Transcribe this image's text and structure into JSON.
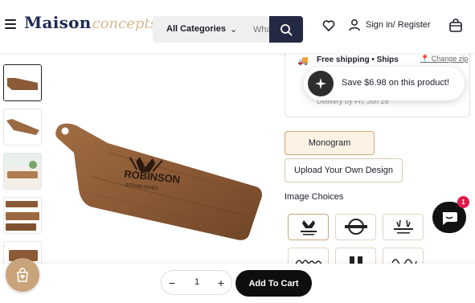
{
  "header": {
    "logo_main": "Maison",
    "logo_sub": "concepts",
    "category_select": "All Categories",
    "search_placeholder": "What are you looking for?",
    "signin_label": "Sign in/ Register"
  },
  "shipping": {
    "title": "Free shipping • Ships",
    "change_zip": "Change zip",
    "delivery": "Delivery by Fri, Jun 28"
  },
  "promo": {
    "text": "Save $6.98 on this product!"
  },
  "options": {
    "monogram_label": "Monogram",
    "upload_label": "Upload Your Own Design",
    "image_choices_label": "Image Choices"
  },
  "chat": {
    "badge_count": "1"
  },
  "product_image": {
    "engraving_line1": "ROBINSON",
    "engraving_line2": "ESTABLISHED"
  },
  "cart_bar": {
    "quantity": "1",
    "minus": "−",
    "plus": "+",
    "add_to_cart": "Add To Cart"
  },
  "colors": {
    "navy": "#242842",
    "gold": "#d9b98e",
    "wood": "#8b5a36",
    "bag_button": "#c9a47a",
    "badge": "#e2184b"
  }
}
